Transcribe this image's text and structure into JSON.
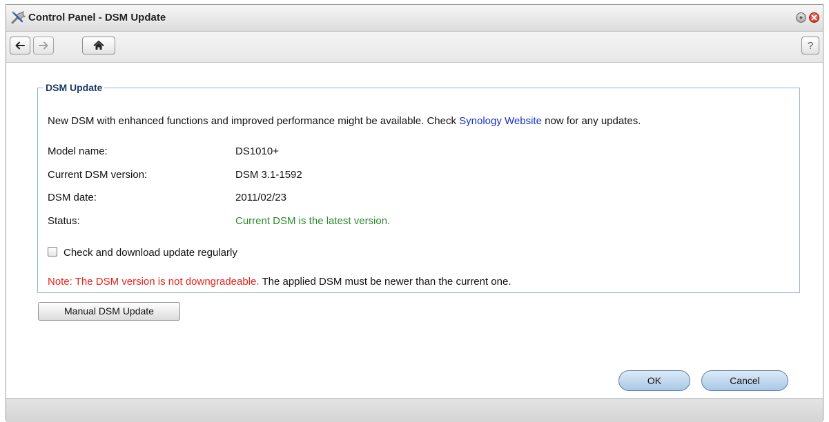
{
  "window": {
    "title": "Control Panel - DSM Update",
    "app_icon": "control-panel-icon"
  },
  "toolbar": {
    "back_icon": "arrow-left-icon",
    "forward_icon": "arrow-right-icon",
    "home_icon": "home-icon",
    "help_label": "?"
  },
  "section": {
    "legend": "DSM Update",
    "description_before": "New DSM with enhanced functions and improved performance might be available. Check ",
    "description_link": "Synology Website",
    "description_after": " now for any updates."
  },
  "info": [
    {
      "label": "Model name:",
      "value": "DS1010+"
    },
    {
      "label": "Current DSM version:",
      "value": "DSM 3.1-1592"
    },
    {
      "label": "DSM date:",
      "value": "2011/02/23"
    },
    {
      "label": "Status:",
      "value": "Current DSM is the latest version."
    }
  ],
  "checkbox": {
    "label": "Check and download update regularly",
    "checked": false
  },
  "note": {
    "warning": "Note: The DSM version is not downgradeable.",
    "rest": " The applied DSM must be newer than the current one."
  },
  "buttons": {
    "manual_update": "Manual DSM Update",
    "ok": "OK",
    "cancel": "Cancel"
  },
  "colors": {
    "link": "#1a2ec8",
    "status_ok": "#2a8a2a",
    "warning": "#e8221a",
    "group_border": "#8fb3d1",
    "legend_text": "#1a3a66"
  }
}
